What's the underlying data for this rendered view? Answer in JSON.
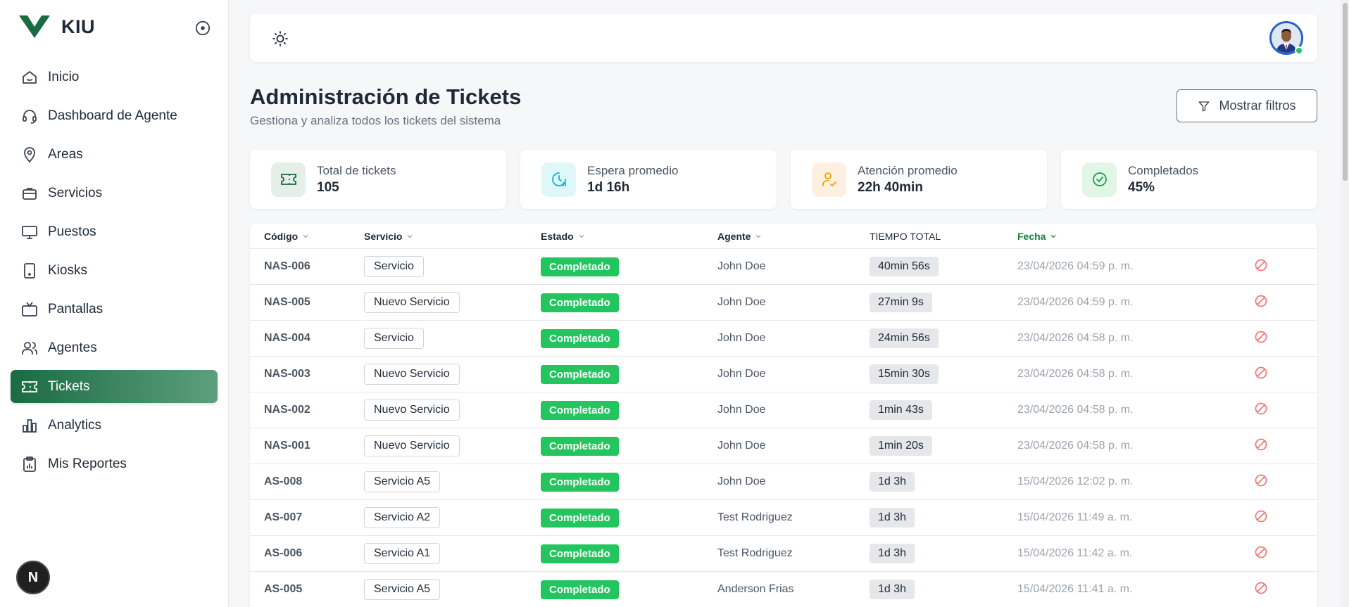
{
  "brand": {
    "name": "KIU"
  },
  "sidebar": {
    "items": [
      {
        "label": "Inicio",
        "icon": "home-icon"
      },
      {
        "label": "Dashboard de Agente",
        "icon": "headset-icon"
      },
      {
        "label": "Areas",
        "icon": "map-pin-icon"
      },
      {
        "label": "Servicios",
        "icon": "briefcase-icon"
      },
      {
        "label": "Puestos",
        "icon": "monitor-icon"
      },
      {
        "label": "Kiosks",
        "icon": "tablet-icon"
      },
      {
        "label": "Pantallas",
        "icon": "tv-icon"
      },
      {
        "label": "Agentes",
        "icon": "users-icon"
      },
      {
        "label": "Tickets",
        "icon": "ticket-icon",
        "active": true
      },
      {
        "label": "Analytics",
        "icon": "bar-chart-icon"
      },
      {
        "label": "Mis Reportes",
        "icon": "clipboard-icon"
      }
    ],
    "badge": "N"
  },
  "header": {
    "title": "Administración de Tickets",
    "subtitle": "Gestiona y analiza todos los tickets del sistema",
    "filters_label": "Mostrar filtros"
  },
  "stats": [
    {
      "label": "Total de tickets",
      "value": "105",
      "icon": "ticket-icon",
      "bg": "#e4efe9",
      "color": "#1a6b42"
    },
    {
      "label": "Espera promedio",
      "value": "1d 16h",
      "icon": "clock-icon",
      "bg": "#dff7f8",
      "color": "#06b6d4"
    },
    {
      "label": "Atención promedio",
      "value": "22h 40min",
      "icon": "user-check-icon",
      "bg": "#fdf0e0",
      "color": "#f59e0b"
    },
    {
      "label": "Completados",
      "value": "45%",
      "icon": "check-circle-icon",
      "bg": "#e2f6e8",
      "color": "#16a34a"
    }
  ],
  "table": {
    "columns": [
      "Código",
      "Servicio",
      "Estado",
      "Agente",
      "TIEMPO TOTAL",
      "Fecha"
    ],
    "rows": [
      {
        "code": "NAS-006",
        "service": "Servicio",
        "status": "Completado",
        "agent": "John Doe",
        "time": "40min 56s",
        "date": "23/04/2026 04:59 p. m."
      },
      {
        "code": "NAS-005",
        "service": "Nuevo Servicio",
        "status": "Completado",
        "agent": "John Doe",
        "time": "27min 9s",
        "date": "23/04/2026 04:59 p. m."
      },
      {
        "code": "NAS-004",
        "service": "Servicio",
        "status": "Completado",
        "agent": "John Doe",
        "time": "24min 56s",
        "date": "23/04/2026 04:58 p. m."
      },
      {
        "code": "NAS-003",
        "service": "Nuevo Servicio",
        "status": "Completado",
        "agent": "John Doe",
        "time": "15min 30s",
        "date": "23/04/2026 04:58 p. m."
      },
      {
        "code": "NAS-002",
        "service": "Nuevo Servicio",
        "status": "Completado",
        "agent": "John Doe",
        "time": "1min 43s",
        "date": "23/04/2026 04:58 p. m."
      },
      {
        "code": "NAS-001",
        "service": "Nuevo Servicio",
        "status": "Completado",
        "agent": "John Doe",
        "time": "1min 20s",
        "date": "23/04/2026 04:58 p. m."
      },
      {
        "code": "AS-008",
        "service": "Servicio A5",
        "status": "Completado",
        "agent": "John Doe",
        "time": "1d 3h",
        "date": "15/04/2026 12:02 p. m."
      },
      {
        "code": "AS-007",
        "service": "Servicio A2",
        "status": "Completado",
        "agent": "Test Rodriguez",
        "time": "1d 3h",
        "date": "15/04/2026 11:49 a. m."
      },
      {
        "code": "AS-006",
        "service": "Servicio A1",
        "status": "Completado",
        "agent": "Test Rodriguez",
        "time": "1d 3h",
        "date": "15/04/2026 11:42 a. m."
      },
      {
        "code": "AS-005",
        "service": "Servicio A5",
        "status": "Completado",
        "agent": "Anderson Frias",
        "time": "1d 3h",
        "date": "15/04/2026 11:41 a. m."
      }
    ]
  }
}
